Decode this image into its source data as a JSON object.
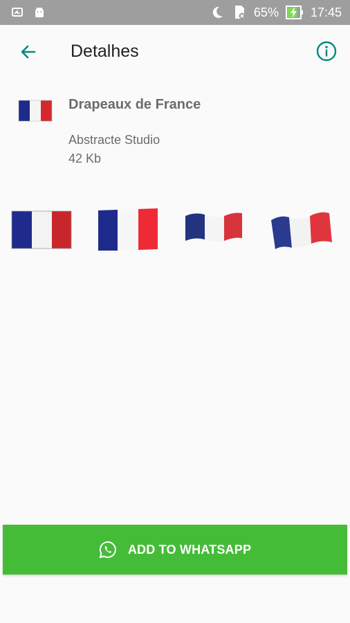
{
  "status_bar": {
    "battery": "65%",
    "time": "17:45"
  },
  "app_bar": {
    "title": "Detalhes"
  },
  "pack": {
    "name": "Drapeaux de France",
    "publisher": "Abstracte Studio",
    "size": "42 Kb"
  },
  "stickers": [
    {
      "name": "flag-sticker-1"
    },
    {
      "name": "flag-sticker-2"
    },
    {
      "name": "flag-sticker-3"
    },
    {
      "name": "flag-sticker-4"
    }
  ],
  "add_button": {
    "label": "ADD TO WHATSAPP"
  },
  "colors": {
    "accent": "#00897b",
    "button": "#45bc38",
    "flag_blue": "#1e2a8c",
    "flag_red": "#d42a2f"
  }
}
